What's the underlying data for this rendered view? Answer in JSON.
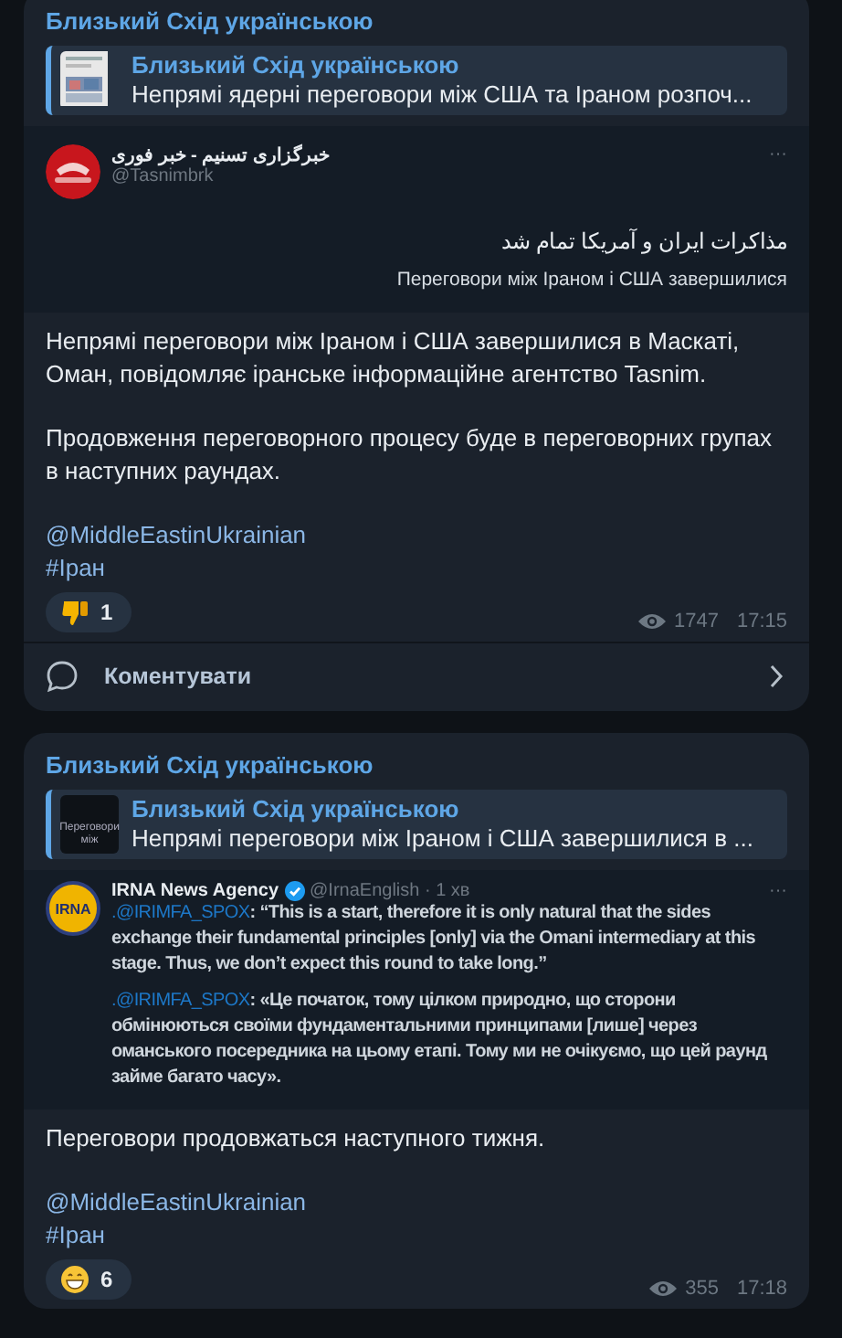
{
  "posts": [
    {
      "channel": "Близький Схід українською",
      "reply": {
        "author": "Близький Схід українською",
        "text": "Непрямі ядерні переговори між США та Іраном розпоч..."
      },
      "embed": {
        "kind": "tweet_stacked",
        "avatar": {
          "kind": "red"
        },
        "name": "خبرگزاری تسنیم - خبر فوری",
        "handle": "@Tasnimbrk",
        "more": "···",
        "body": [
          {
            "kind": "rtl",
            "text": "مذاکرات ایران و آمریکا تمام شد"
          },
          {
            "kind": "caption",
            "text": "Переговори між Іраном і США завершилися"
          }
        ]
      },
      "paragraphs": [
        "Непрямі переговори між Іраном і США завершилися в Маскаті, Оман, повідомляє іранське інформаційне агентство Tasnim.",
        "Продовження переговорного процесу буде в переговорних групах в наступних раундах."
      ],
      "mention": "@MiddleEastinUkrainian",
      "hashtag": "#Іран",
      "reaction": {
        "kind": "thumbs_down",
        "count": "1"
      },
      "views": "1747",
      "time": "17:15",
      "comments": "Коментувати"
    },
    {
      "channel": "Близький Схід українською",
      "reply": {
        "author": "Близький Схід українською",
        "text": "Непрямі переговори між Іраном і США завершилися в ...",
        "thumb": {
          "kind": "text",
          "text": "Переговори між"
        }
      },
      "embed": {
        "kind": "tweet_inline",
        "avatar": {
          "kind": "yellow",
          "text": "IRNA"
        },
        "name": "IRNA News Agency",
        "verified": true,
        "handle": "@IrnaEnglish · 1 хв",
        "more": "···",
        "body": [
          {
            "kind": "quote",
            "mention": ".@IRIMFA_SPOX",
            "text": ": “This is a start, therefore it is only natural that the sides exchange their fundamental principles [only] via the Omani intermediary at this stage. Thus, we don’t expect this round to take long.”"
          },
          {
            "kind": "quote",
            "mention": ".@IRIMFA_SPOX",
            "text": ": «Це початок, тому цілком природно, що сторони обмінюються своїми фундаментальними принципами [лише] через оманського посередника на цьому етапі. Тому ми не очікуємо, що цей раунд займе багато часу»."
          }
        ]
      },
      "paragraphs": [
        "Переговори продовжаться наступного тижня."
      ],
      "mention": "@MiddleEastinUkrainian",
      "hashtag": "#Іран",
      "reaction": {
        "kind": "grin",
        "count": "6"
      },
      "views": "355",
      "time": "17:18"
    }
  ]
}
